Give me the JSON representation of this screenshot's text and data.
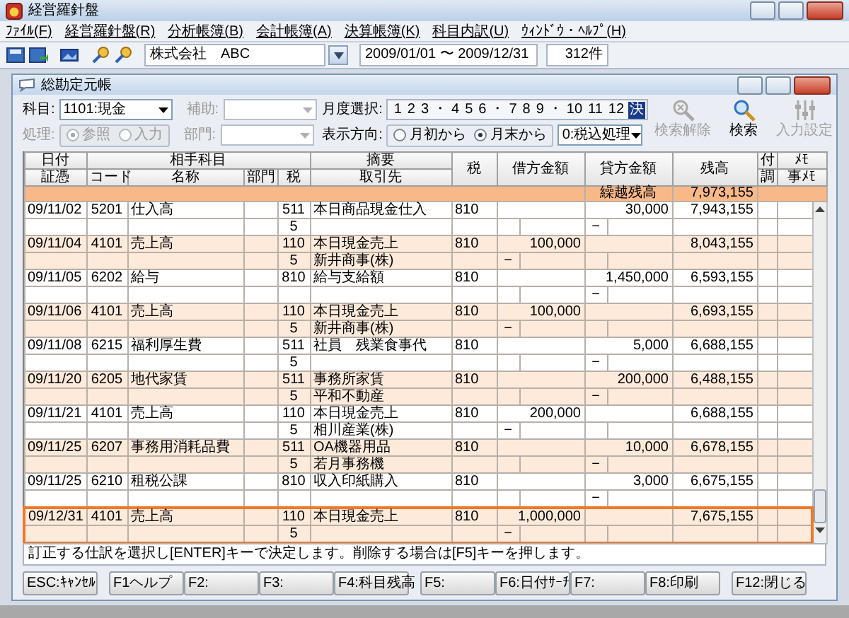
{
  "window": {
    "title": "経営羅針盤"
  },
  "menu": [
    {
      "label": "ﾌｧｲﾙ(F)"
    },
    {
      "label": "経営羅針盤(R)"
    },
    {
      "label": "分析帳簿(B)"
    },
    {
      "label": "会計帳簿(A)"
    },
    {
      "label": "決算帳簿(K)"
    },
    {
      "label": "科目内訳(U)"
    },
    {
      "label": "ｳｨﾝﾄﾞｳ・ﾍﾙﾌﾟ(H)"
    }
  ],
  "toolbar": {
    "company": "株式会社　ABC",
    "period": "2009/01/01 〜 2009/12/31",
    "count": "312件"
  },
  "ledger": {
    "title": "総勘定元帳",
    "account": {
      "label": "科目:",
      "value": "1101:現金"
    },
    "sub_account": {
      "label": "補助:",
      "disabled": true
    },
    "process": {
      "label": "処理:",
      "disabled": true,
      "options": [
        {
          "label": "参照",
          "selected": true
        },
        {
          "label": "入力",
          "selected": false
        }
      ]
    },
    "department": {
      "label": "部門:",
      "disabled": true
    },
    "month_select": {
      "label": "月度選択:",
      "items": [
        {
          "label": "1",
          "kind": "month",
          "selected": false
        },
        {
          "label": "2",
          "kind": "month",
          "selected": false
        },
        {
          "label": "3",
          "kind": "month",
          "selected": false
        },
        {
          "label": "・",
          "kind": "separator"
        },
        {
          "label": "4",
          "kind": "month",
          "selected": false
        },
        {
          "label": "5",
          "kind": "month",
          "selected": false
        },
        {
          "label": "6",
          "kind": "month",
          "selected": false
        },
        {
          "label": "・",
          "kind": "separator"
        },
        {
          "label": "7",
          "kind": "month",
          "selected": false
        },
        {
          "label": "8",
          "kind": "month",
          "selected": false
        },
        {
          "label": "9",
          "kind": "month",
          "selected": false
        },
        {
          "label": "・",
          "kind": "separator"
        },
        {
          "label": "10",
          "kind": "month",
          "selected": false
        },
        {
          "label": "11",
          "kind": "month",
          "selected": false
        },
        {
          "label": "12",
          "kind": "month",
          "selected": false
        },
        {
          "label": "決",
          "kind": "month",
          "selected": true
        }
      ]
    },
    "direction": {
      "label": "表示方向:",
      "options": [
        {
          "label": "月初から",
          "selected": false
        },
        {
          "label": "月末から",
          "selected": true
        }
      ]
    },
    "tax_mode": {
      "value": "0:税込処理"
    },
    "actions": [
      {
        "label": "検索解除",
        "kind": "clear",
        "disabled": true
      },
      {
        "label": "検索",
        "kind": "search",
        "disabled": false
      },
      {
        "label": "入力設定",
        "kind": "settings",
        "disabled": true
      }
    ],
    "header": {
      "top": [
        "日付",
        "相手科目",
        "摘要",
        "税",
        "借方金額",
        "貸方金額",
        "残高",
        "付",
        "ﾒﾓ"
      ],
      "bottom": [
        "証憑",
        "コード",
        "名称",
        "部門",
        "税",
        "取引先",
        "調",
        "事ﾒﾓ"
      ]
    },
    "carry_forward": {
      "label": "繰越残高",
      "balance": "7,973,155"
    },
    "entries": [
      {
        "date": "09/11/02",
        "code": "5201",
        "account": "仕入高",
        "tax_code": "511",
        "description": "本日商品現金仕入",
        "tax": "810",
        "credit": "30,000",
        "balance": "7,943,155",
        "tax_rate": "5",
        "mark": "−",
        "kind": "credit",
        "selected": false
      },
      {
        "date": "09/11/04",
        "code": "4101",
        "account": "売上高",
        "tax_code": "110",
        "description": "本日現金売上",
        "tax": "810",
        "debit": "100,000",
        "balance": "8,043,155",
        "tax_rate": "5",
        "partner": "新井商事(株)",
        "mark": "−",
        "kind": "debit",
        "selected": false
      },
      {
        "date": "09/11/05",
        "code": "6202",
        "account": "給与",
        "tax_code": "810",
        "description": "給与支給額",
        "tax": "810",
        "credit": "1,450,000",
        "balance": "6,593,155",
        "mark": "−",
        "kind": "credit",
        "selected": false
      },
      {
        "date": "09/11/06",
        "code": "4101",
        "account": "売上高",
        "tax_code": "110",
        "description": "本日現金売上",
        "tax": "810",
        "debit": "100,000",
        "balance": "6,693,155",
        "tax_rate": "5",
        "partner": "新井商事(株)",
        "mark": "−",
        "kind": "debit",
        "selected": false
      },
      {
        "date": "09/11/08",
        "code": "6215",
        "account": "福利厚生費",
        "tax_code": "511",
        "description": "社員　残業食事代",
        "tax": "810",
        "credit": "5,000",
        "balance": "6,688,155",
        "tax_rate": "5",
        "mark": "−",
        "kind": "credit",
        "selected": false
      },
      {
        "date": "09/11/20",
        "code": "6205",
        "account": "地代家賃",
        "tax_code": "511",
        "description": "事務所家賃",
        "tax": "810",
        "credit": "200,000",
        "balance": "6,488,155",
        "tax_rate": "5",
        "partner": "平和不動産",
        "mark": "−",
        "kind": "credit",
        "selected": false
      },
      {
        "date": "09/11/21",
        "code": "4101",
        "account": "売上高",
        "tax_code": "110",
        "description": "本日現金売上",
        "tax": "810",
        "debit": "200,000",
        "balance": "6,688,155",
        "tax_rate": "5",
        "partner": "相川産業(株)",
        "mark": "−",
        "kind": "debit",
        "selected": false
      },
      {
        "date": "09/11/25",
        "code": "6207",
        "account": "事務用消耗品費",
        "tax_code": "511",
        "description": "OA機器用品",
        "tax": "810",
        "credit": "10,000",
        "balance": "6,678,155",
        "tax_rate": "5",
        "partner": "若月事務機",
        "mark": "−",
        "kind": "credit",
        "selected": false
      },
      {
        "date": "09/11/25",
        "code": "6210",
        "account": "租税公課",
        "tax_code": "810",
        "description": "収入印紙購入",
        "tax": "810",
        "credit": "3,000",
        "balance": "6,675,155",
        "mark": "−",
        "kind": "credit",
        "selected": false
      },
      {
        "date": "09/12/31",
        "code": "4101",
        "account": "売上高",
        "tax_code": "110",
        "description": "本日現金売上",
        "tax": "810",
        "debit": "1,000,000",
        "balance": "7,675,155",
        "tax_rate": "5",
        "mark": "−",
        "kind": "debit",
        "selected": true
      }
    ],
    "status_message": "訂正する仕訳を選択し[ENTER]キーで決定します。削除する場合は[F5]キーを押します。",
    "function_keys": [
      {
        "label": "ESC:ｷｬﾝｾﾙ"
      },
      {
        "label": "F1ヘルプ"
      },
      {
        "label": "F2:"
      },
      {
        "label": "F3:"
      },
      {
        "label": "F4:科目残高"
      },
      {
        "label": "F5:"
      },
      {
        "label": "F6:日付ｻｰﾁ"
      },
      {
        "label": "F7:"
      },
      {
        "label": "F8:印刷"
      },
      {
        "label": "F12:閉じる"
      }
    ]
  }
}
